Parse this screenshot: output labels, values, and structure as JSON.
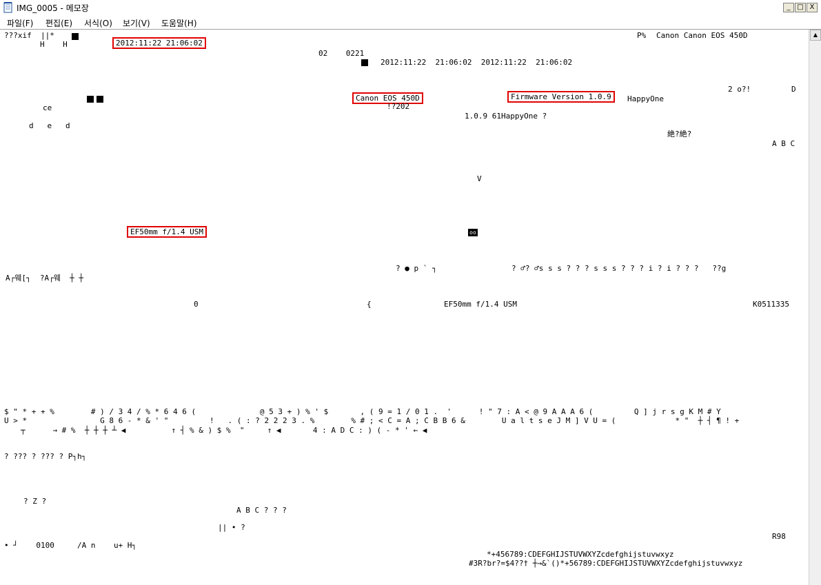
{
  "window": {
    "title": "IMG_0005 - 메모장",
    "minimize": "_",
    "maximize": "□",
    "close": "X"
  },
  "menu": [
    "파일(F)",
    "편집(E)",
    "서식(O)",
    "보기(V)",
    "도움말(H)"
  ],
  "highlights": {
    "datetime": "2012:11:22 21:06:02",
    "camera": "Canon EOS 450D",
    "firmware": "Firmware Version 1.0.9",
    "lens": "EF50mm f/1.4 USM"
  },
  "text": {
    "l01": "???xif  ||*",
    "l01b": "Canon Canon EOS 450D",
    "l01c": "P%",
    "l02": "H    H",
    "l02b": "02    0221",
    "l05": "2012:11:22  21:06:02  2012:11:22  21:06:02",
    "l07": "HappyOne",
    "l07b": "2 o?!",
    "l07c": "D",
    "l08": "ce",
    "l08b": "!?202",
    "l09": "1.0.9 61HappyOne ?",
    "l10": "d   e   d",
    "l11": "絶?絶?",
    "l11b": "A B C",
    "v": "V",
    "pps": "? ● p ` ┐",
    "sss": "? ♂? ♂s s s ? ? ? s s s ? ? ? i ? i ? ? ?   ??g",
    "a_row": "A┌웨[┐  ?A┌웨  ┼ ┼",
    "zero": "0",
    "brace": "{",
    "lens2": "EF50mm f/1.4 USM",
    "serial": "K0511335",
    "g1": "$ \" * + + %        # ) / 3 4 / % * 6 4 6 (              @ 5 3 + ) % ' $       , ( 9 = 1 / 0 1 .  '      ! \" 7 : A < @ 9 A A A 6 (         Q ] j r s g K M # Y",
    "g2": "U > *                G 8 6 - * & ' \"         !   . ( : ? 2 2 2 3 . %        % # ; < C = A ; C B B 6 &        U a l t s e J M ] V U = (             * \"  ┼ ┤ ¶ ! +",
    "g3": "┬      → # %  ┼ ┼ ┼ ┴ ◀          ↑ ┤ % & ) $ %  \"     ↑ ◀       4 : A D C : ) ( - * ' ← ◀",
    "g4": "? ??? ? ??? ? P┐h┐",
    "qz": "? Z ?",
    "abc": "A B C ? ? ?",
    "ll": "|| • ?",
    "r98": "R98",
    "bottom1": "• ┘    0100     /A n    u+ H┐",
    "bottom2": "#3R?br?=$4??† ┼→&`()*+56789:CDEFGHIJSTUVWXYZcdefghijstuvwxyz",
    "bottom3": "*+456789:CDEFGHIJSTUVWXYZcdefghijstuvwxyz"
  }
}
